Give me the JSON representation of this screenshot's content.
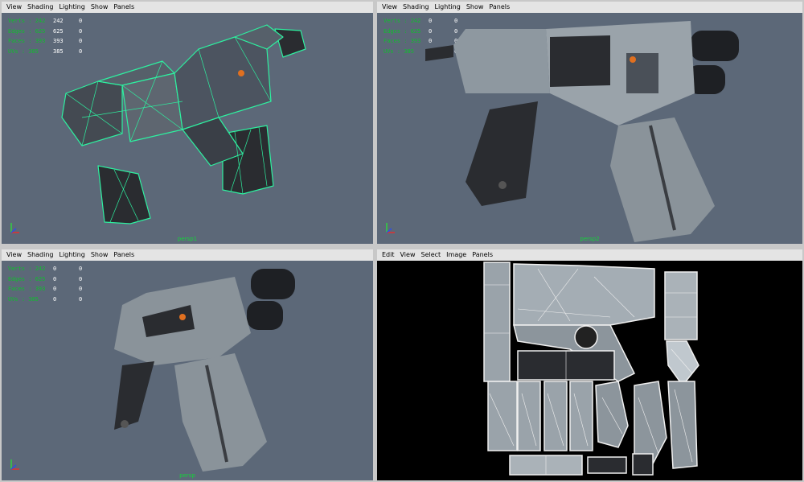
{
  "panels": {
    "menu": [
      "View",
      "Shading",
      "Lighting",
      "Show",
      "Panels"
    ],
    "uv_menu": [
      "Edit",
      "View",
      "Select",
      "Image",
      "Panels"
    ],
    "hud": {
      "rows": [
        {
          "label": "Verts : 242",
          "v1": "242",
          "v2": "0"
        },
        {
          "label": "Edges : 625",
          "v1": "625",
          "v2": "0"
        },
        {
          "label": "Faces : 393",
          "v1": "393",
          "v2": "0"
        },
        {
          "label": "UVs : 385",
          "v1": "385",
          "v2": "0"
        }
      ],
      "rows_alt": [
        {
          "label": "Verts : 242",
          "v1": "0",
          "v2": "0"
        },
        {
          "label": "Edges : 625",
          "v1": "0",
          "v2": "0"
        },
        {
          "label": "Faces : 393",
          "v1": "0",
          "v2": "0"
        },
        {
          "label": "UVs : 385",
          "v1": "0",
          "v2": "0"
        }
      ]
    },
    "cameras": {
      "tl": "persp1",
      "tr": "persp2",
      "bl": "persp"
    },
    "colors": {
      "viewport": "#5c6878",
      "wire": "#2ef0a0",
      "hud": "#0fbe2d"
    }
  }
}
